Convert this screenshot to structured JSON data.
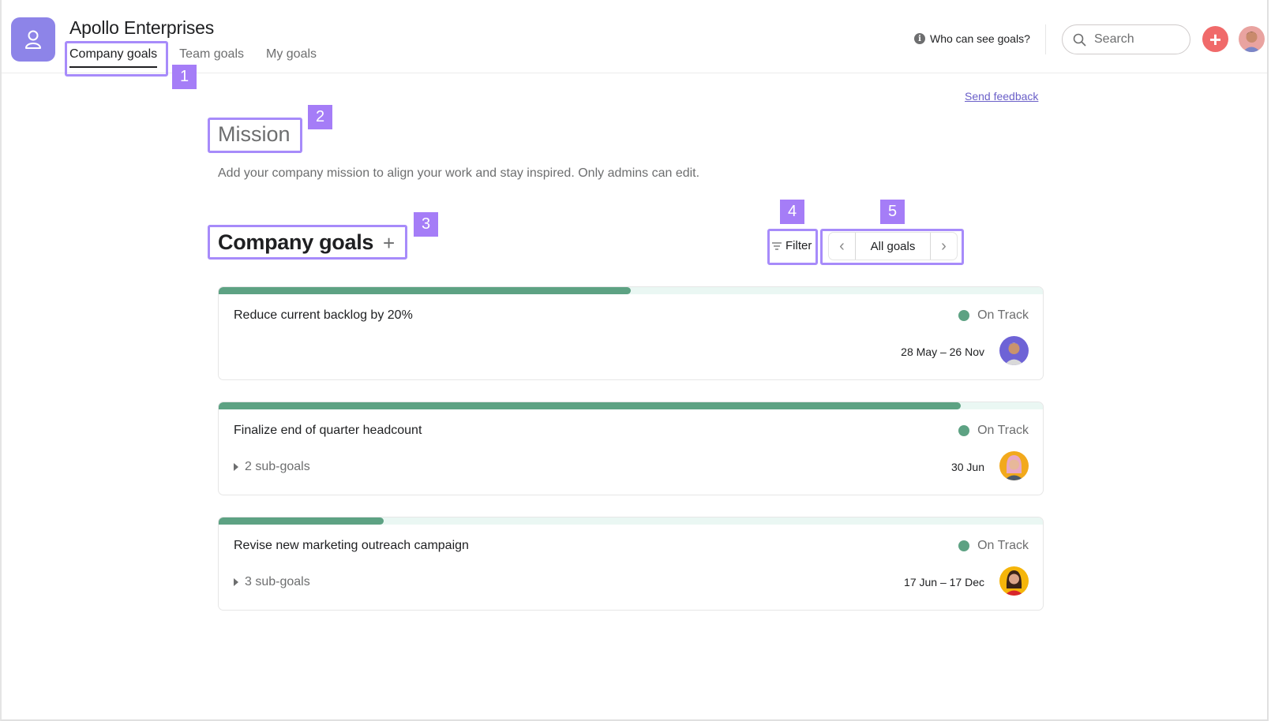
{
  "header": {
    "org_name": "Apollo Enterprises",
    "tabs": [
      {
        "label": "Company goals",
        "active": true
      },
      {
        "label": "Team goals",
        "active": false
      },
      {
        "label": "My goals",
        "active": false
      }
    ],
    "who_can_see": "Who can see goals?",
    "search_placeholder": "Search",
    "add_label": "+",
    "icons": {
      "logo": "people-icon",
      "info": "info-icon",
      "search": "search-icon",
      "add": "plus-icon",
      "avatar": "user-avatar"
    }
  },
  "annotations": [
    "1",
    "2",
    "3",
    "4",
    "5"
  ],
  "feedback_link": "Send feedback",
  "mission": {
    "title": "Mission",
    "description": "Add your company mission to align your work and stay inspired. Only admins can edit."
  },
  "goals_section": {
    "title": "Company goals",
    "add_label": "+",
    "filter_label": "Filter",
    "view_label": "All goals",
    "prev_label": "‹",
    "next_label": "›"
  },
  "goals": [
    {
      "name": "Reduce current backlog by 20%",
      "status": "On Track",
      "status_color": "#5da283",
      "dates": "28 May – 26 Nov",
      "subgoals": null,
      "progress": 0.5,
      "avatar_bg": "#6e63d6"
    },
    {
      "name": "Finalize end of quarter headcount",
      "status": "On Track",
      "status_color": "#5da283",
      "dates": "30 Jun",
      "subgoals": "2 sub-goals",
      "progress": 0.9,
      "avatar_bg": "#f2a91c"
    },
    {
      "name": "Revise new marketing outreach campaign",
      "status": "On Track",
      "status_color": "#5da283",
      "dates": "17 Jun – 17 Dec",
      "subgoals": "3 sub-goals",
      "progress": 0.2,
      "avatar_bg": "#f5b50a"
    }
  ],
  "colors": {
    "accent": "#8d84e8",
    "annotation": "#a57df7",
    "on_track": "#5da283",
    "add_button": "#f06a6a"
  }
}
